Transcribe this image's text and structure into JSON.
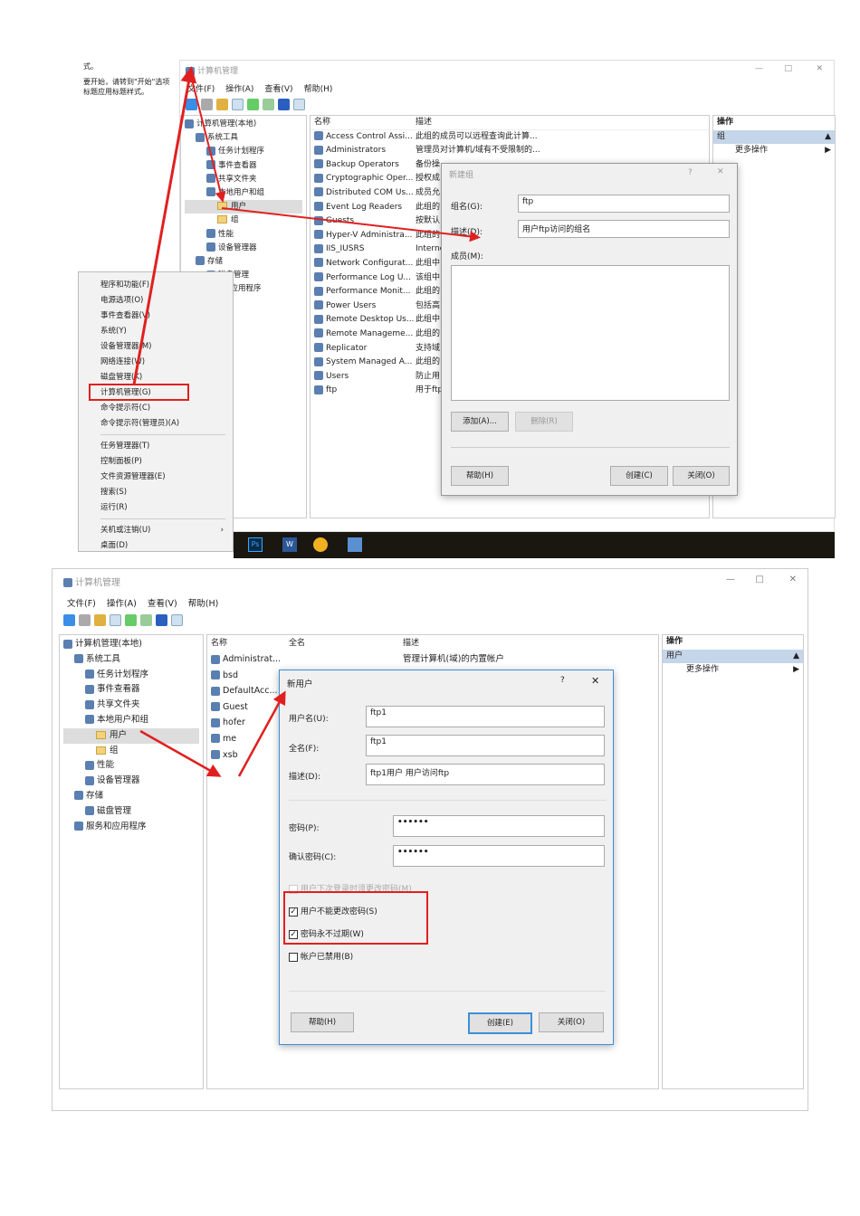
{
  "doc_left": {
    "line1": "式。",
    "line2": "要开始，请转到\"开始\"选项",
    "line3": "标题应用标题样式。"
  },
  "s1": {
    "title": "计算机管理",
    "menu": [
      "文件(F)",
      "操作(A)",
      "查看(V)",
      "帮助(H)"
    ],
    "tree": [
      "计算机管理(本地)",
      "系统工具",
      "任务计划程序",
      "事件查看器",
      "共享文件夹",
      "本地用户和组",
      "用户",
      "组",
      "性能",
      "设备管理器",
      "存储",
      "磁盘管理",
      "服务和应用程序"
    ],
    "list_headers": [
      "名称",
      "描述"
    ],
    "groups": [
      [
        "Access Control Assi...",
        "此组的成员可以远程查询此计算..."
      ],
      [
        "Administrators",
        "管理员对计算机/域有不受限制的..."
      ],
      [
        "Backup Operators",
        "备份操"
      ],
      [
        "Cryptographic Oper...",
        "授权成"
      ],
      [
        "Distributed COM Us...",
        "成员允"
      ],
      [
        "Event Log Readers",
        "此组的"
      ],
      [
        "Guests",
        "按默认"
      ],
      [
        "Hyper-V Administra...",
        "此组的"
      ],
      [
        "IIS_IUSRS",
        "Interne"
      ],
      [
        "Network Configurat...",
        "此组中"
      ],
      [
        "Performance Log U...",
        "该组中"
      ],
      [
        "Performance Monit...",
        "此组的"
      ],
      [
        "Power Users",
        "包括高"
      ],
      [
        "Remote Desktop Us...",
        "此组中"
      ],
      [
        "Remote Manageme...",
        "此组的"
      ],
      [
        "Replicator",
        "支持域"
      ],
      [
        "System Managed A...",
        "此组的"
      ],
      [
        "Users",
        "防止用"
      ],
      [
        "ftp",
        "用于ftp"
      ]
    ],
    "actions": {
      "header": "操作",
      "section": "组",
      "more": "更多操作"
    },
    "dialog": {
      "title": "新建组",
      "help": "?",
      "close": "✕",
      "name_label": "组名(G):",
      "name_value": "ftp",
      "desc_label": "描述(D):",
      "desc_value": "用户ftp访问的组名",
      "members_label": "成员(M):",
      "add": "添加(A)...",
      "remove": "删除(R)",
      "help_btn": "帮助(H)",
      "create": "创建(C)",
      "close_btn": "关闭(O)"
    },
    "context_menu": [
      "程序和功能(F)",
      "电源选项(O)",
      "事件查看器(V)",
      "系统(Y)",
      "设备管理器(M)",
      "网络连接(W)",
      "磁盘管理(K)",
      "计算机管理(G)",
      "命令提示符(C)",
      "命令提示符(管理员)(A)",
      "任务管理器(T)",
      "控制面板(P)",
      "文件资源管理器(E)",
      "搜索(S)",
      "运行(R)",
      "关机或注销(U)",
      "桌面(D)"
    ],
    "taskbar": {
      "ps": "Ps",
      "word": "W"
    }
  },
  "s2": {
    "title": "计算机管理",
    "menu": [
      "文件(F)",
      "操作(A)",
      "查看(V)",
      "帮助(H)"
    ],
    "tree": [
      "计算机管理(本地)",
      "系统工具",
      "任务计划程序",
      "事件查看器",
      "共享文件夹",
      "本地用户和组",
      "用户",
      "组",
      "性能",
      "设备管理器",
      "存储",
      "磁盘管理",
      "服务和应用程序"
    ],
    "list_headers": [
      "名称",
      "全名",
      "描述"
    ],
    "users": [
      [
        "Administrat...",
        "",
        "管理计算机(域)的内置帐户"
      ],
      [
        "bsd",
        "",
        ""
      ],
      [
        "DefaultAcc...",
        "",
        ""
      ],
      [
        "Guest",
        "",
        ""
      ],
      [
        "hofer",
        "",
        ""
      ],
      [
        "me",
        "",
        ""
      ],
      [
        "xsb",
        "",
        ""
      ]
    ],
    "actions": {
      "header": "操作",
      "section": "用户",
      "more": "更多操作"
    },
    "dialog": {
      "title": "新用户",
      "help": "?",
      "close": "✕",
      "username_label": "用户名(U):",
      "username_value": "ftp1",
      "fullname_label": "全名(F):",
      "fullname_value": "ftp1",
      "desc_label": "描述(D):",
      "desc_value": "ftp1用户 用户访问ftp",
      "pw_label": "密码(P):",
      "pw_value": "••••••",
      "pw2_label": "确认密码(C):",
      "pw2_value": "••••••",
      "chk_must_change": "用户下次登录时须更改密码(M)",
      "chk_cannot_change": "用户不能更改密码(S)",
      "chk_never_expire": "密码永不过期(W)",
      "chk_disabled": "帐户已禁用(B)",
      "must_change": false,
      "cannot_change": true,
      "never_expire": true,
      "disabled": false,
      "help_btn": "帮助(H)",
      "create": "创建(E)",
      "close_btn": "关闭(O)"
    }
  },
  "colors": {
    "annotation": "#e02020",
    "selection": "#c5d5ea",
    "taskbar": "#1a1610"
  }
}
